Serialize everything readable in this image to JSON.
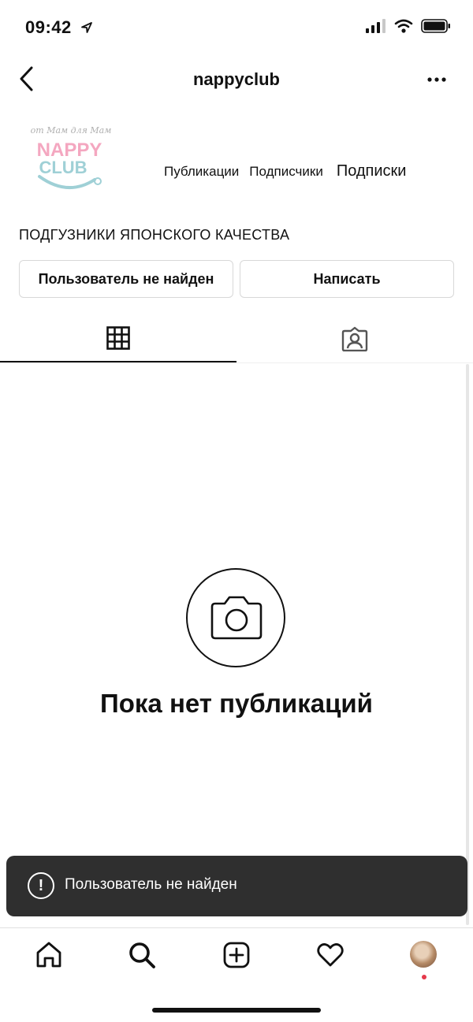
{
  "status_bar": {
    "time": "09:42"
  },
  "nav": {
    "title": "nappyclub"
  },
  "profile": {
    "logo": {
      "top_text": "от Мам для Мам",
      "line1": "NAPPY",
      "line2": "CLUB",
      "colors": {
        "pink": "#f4a7c0",
        "teal": "#9fd0d6"
      }
    },
    "stats": {
      "posts_label": "Публикации",
      "followers_label": "Подписчики",
      "following_label": "Подписки"
    },
    "bio": "ПОДГУЗНИКИ ЯПОНСКОГО КАЧЕСТВА",
    "buttons": {
      "primary": "Пользователь не найден",
      "message": "Написать"
    }
  },
  "tabs": {
    "grid_icon": "grid-icon",
    "tagged_icon": "tagged-person-icon",
    "active": "grid"
  },
  "empty_state": {
    "icon": "camera-icon",
    "text": "Пока нет публикаций"
  },
  "toast": {
    "icon": "exclamation-icon",
    "text": "Пользователь не найден"
  },
  "bottom_nav": {
    "items": [
      "home-icon",
      "search-icon",
      "add-post-icon",
      "heart-icon",
      "profile-avatar"
    ]
  },
  "colors": {
    "toast_bg": "#2f2f2f",
    "notification_dot": "#e5394b",
    "border": "#d8d8d8"
  }
}
